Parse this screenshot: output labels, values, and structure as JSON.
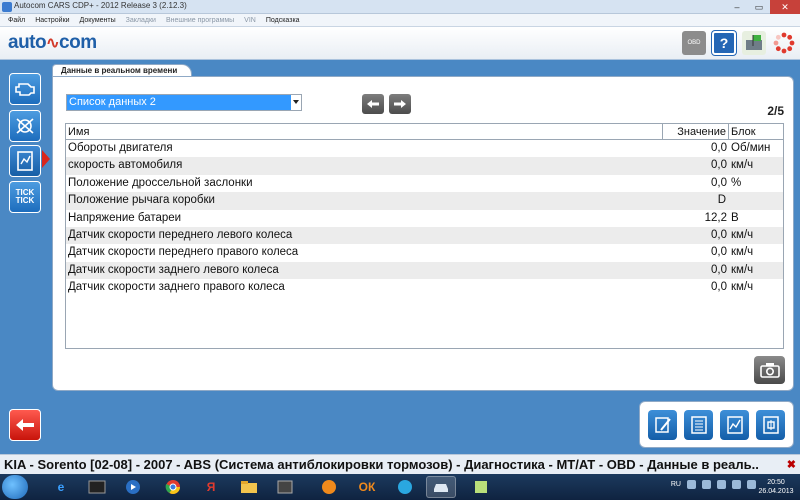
{
  "window": {
    "title": "Autocom CARS CDP+ - 2012 Release 3 (2.12.3)"
  },
  "menu": [
    {
      "label": "Файл",
      "enabled": true
    },
    {
      "label": "Настройки",
      "enabled": true
    },
    {
      "label": "Документы",
      "enabled": true
    },
    {
      "label": "Закладки",
      "enabled": false
    },
    {
      "label": "Внешние программы",
      "enabled": false
    },
    {
      "label": "VIN",
      "enabled": false
    },
    {
      "label": "Подсказка",
      "enabled": true
    }
  ],
  "logo": {
    "left": "auto",
    "accent": "∿",
    "right": "com"
  },
  "toolbar": {
    "obd_label": "OBD",
    "help_label": "?"
  },
  "panel": {
    "tab_label": "Данные в реальном времени",
    "selected_list": "Список данных 2",
    "page": "2/5"
  },
  "table": {
    "headers": {
      "name": "Имя",
      "value": "Значение",
      "unit": "Блок"
    },
    "rows": [
      {
        "name": "Обороты двигателя",
        "value": "0,0",
        "unit": "Об/мин"
      },
      {
        "name": "скорость автомобиля",
        "value": "0,0",
        "unit": "км/ч"
      },
      {
        "name": "Положение дроссельной заслонки",
        "value": "0,0",
        "unit": "%"
      },
      {
        "name": "Положение рычага коробки",
        "value": "D",
        "unit": ""
      },
      {
        "name": "Напряжение батареи",
        "value": "12,2",
        "unit": "В"
      },
      {
        "name": "Датчик скорости переднего левого колеса",
        "value": "0,0",
        "unit": "км/ч"
      },
      {
        "name": "Датчик скорости переднего правого колеса",
        "value": "0,0",
        "unit": "км/ч"
      },
      {
        "name": "Датчик скорости заднего левого колеса",
        "value": "0,0",
        "unit": "км/ч"
      },
      {
        "name": "Датчик скорости заднего правого колеса",
        "value": "0,0",
        "unit": "км/ч"
      }
    ]
  },
  "left_rail": {
    "tick_label_1": "TICK",
    "tick_label_2": "TICK"
  },
  "status": {
    "path": "KIA - Sorento [02-08] - 2007 - ABS (Система антиблокировки тормозов) - Диагностика - MT/AT - OBD - Данные в реаль..",
    "close": "✖"
  },
  "taskbar": {
    "lang": "RU",
    "time": "20:50",
    "date": "26.04.2013"
  },
  "colors": {
    "background": "#4a88c4",
    "accent_blue": "#1d6dbd",
    "back_red": "#c8140b",
    "selection": "#3399ff"
  },
  "icons": {
    "left_rail": [
      "engine-icon",
      "abs-icon",
      "realtime-data-icon",
      "tick-tick-icon",
      "back-arrow-icon"
    ],
    "bottom_tools": [
      "edit-icon",
      "list-icon",
      "graph-icon",
      "print-icon"
    ]
  }
}
